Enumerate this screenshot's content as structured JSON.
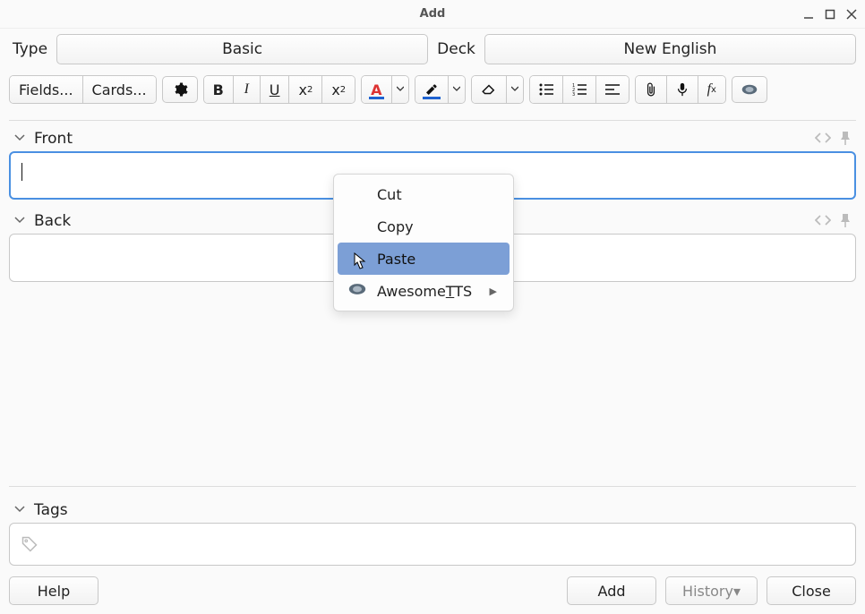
{
  "window": {
    "title": "Add"
  },
  "selectors": {
    "type_label": "Type",
    "type_value": "Basic",
    "deck_label": "Deck",
    "deck_value": "New English"
  },
  "toolbar": {
    "fields": "Fields...",
    "cards": "Cards...",
    "bold": "B",
    "italic": "I",
    "underline": "U",
    "super": "x",
    "sub": "x",
    "textcolor": "A",
    "fx": "f"
  },
  "fields": {
    "front_label": "Front",
    "front_value": "",
    "back_label": "Back",
    "back_value": ""
  },
  "tags": {
    "label": "Tags"
  },
  "buttons": {
    "help": "Help",
    "add": "Add",
    "history": "History▾",
    "close": "Close"
  },
  "context_menu": {
    "cut": "Cut",
    "copy": "Copy",
    "paste": "Paste",
    "awesometts_prefix": "Awesome",
    "awesometts_accel": "T",
    "awesometts_suffix": "TS"
  }
}
